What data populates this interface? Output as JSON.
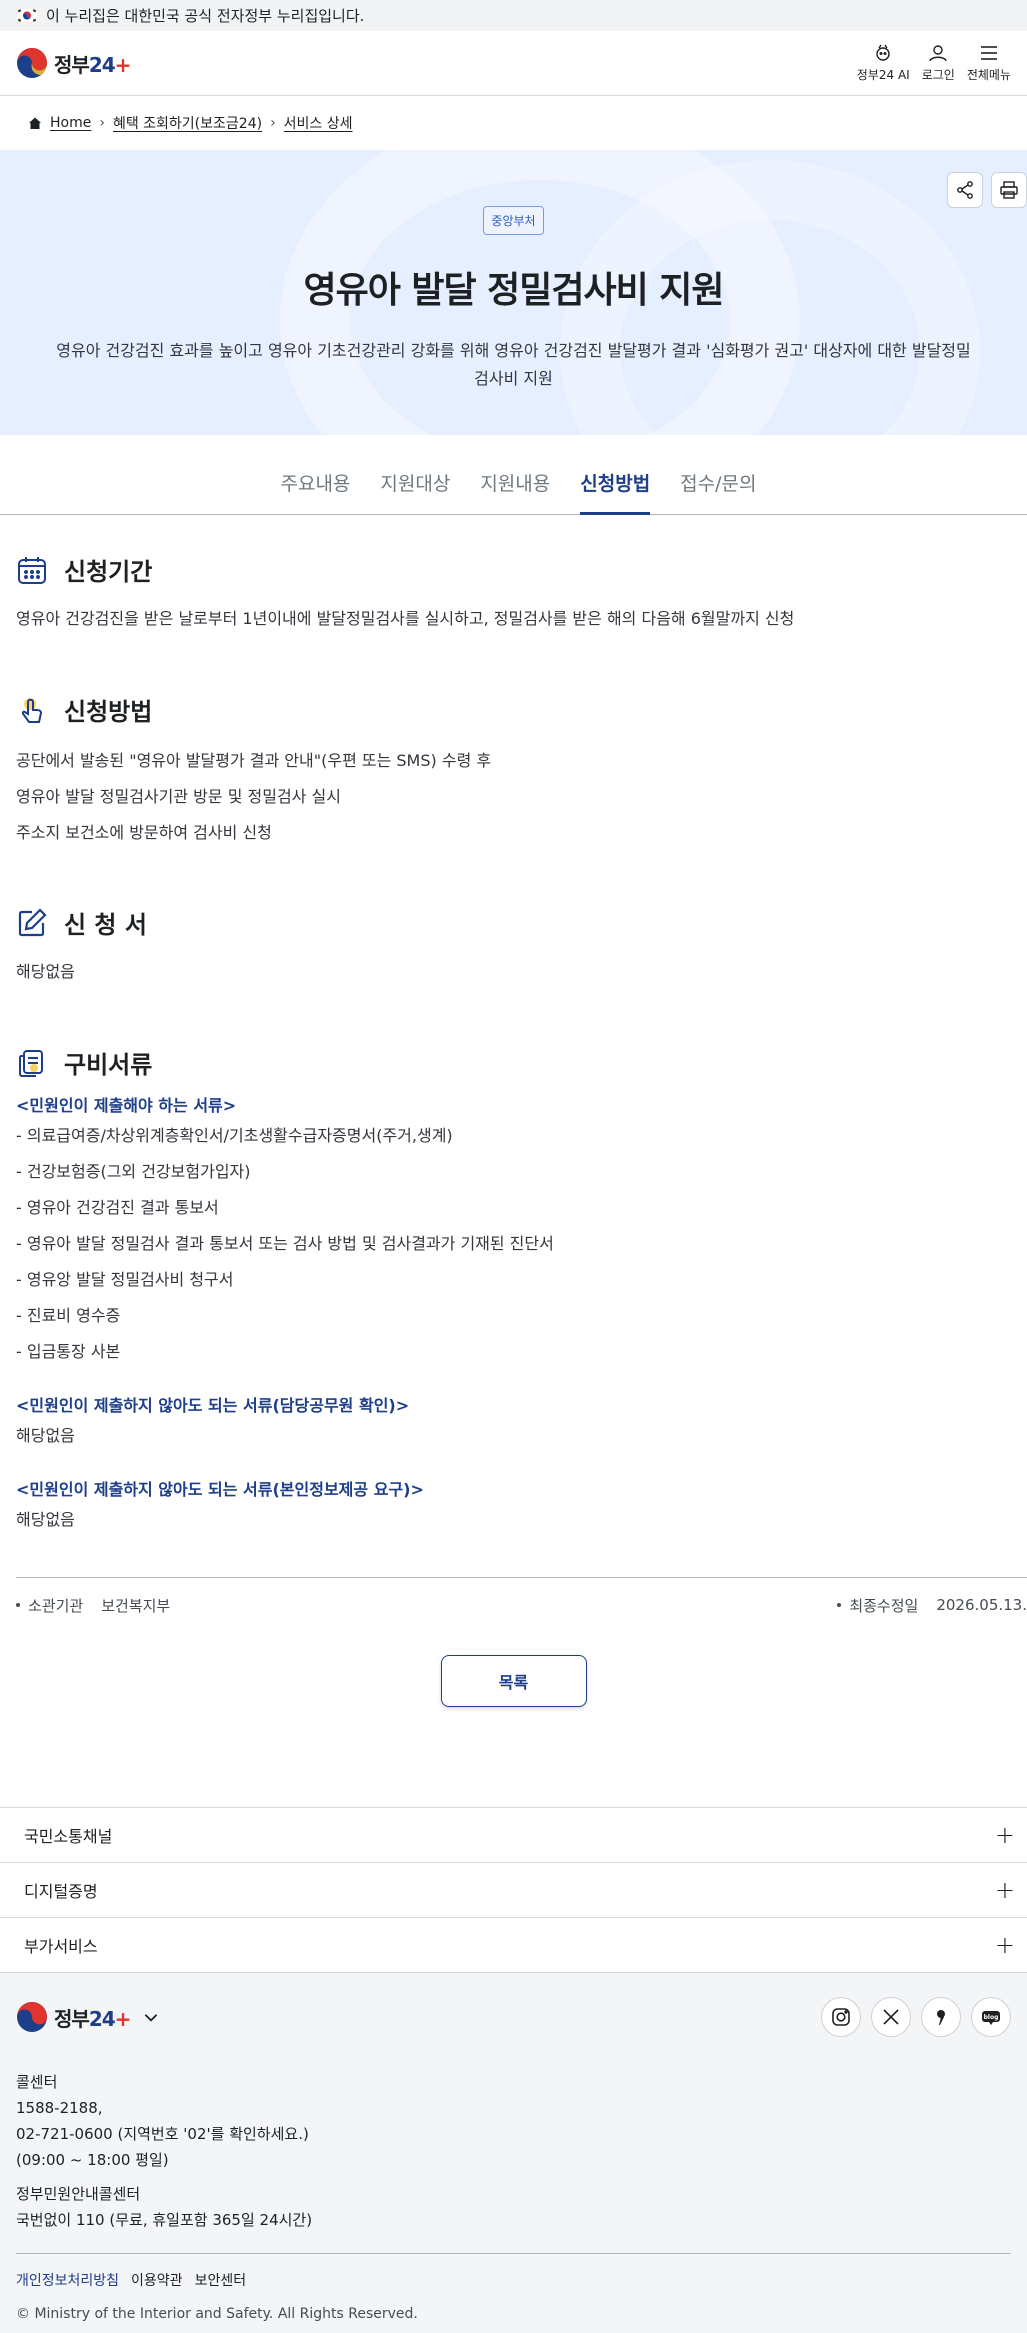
{
  "gov_banner": {
    "text": "이 누리집은 대한민국 공식 전자정부 누리집입니다."
  },
  "header": {
    "logo_text": "정부",
    "logo_num": "24",
    "util": [
      {
        "label": "정부24 AI",
        "icon": "ai-icon"
      },
      {
        "label": "로그인",
        "icon": "user-icon"
      },
      {
        "label": "전체메뉴",
        "icon": "menu-icon"
      }
    ]
  },
  "breadcrumb": {
    "home": "Home",
    "level1": "혜택 조회하기(보조금24)",
    "level2": "서비스 상세"
  },
  "hero": {
    "badge": "중앙부처",
    "title": "영유아 발달 정밀검사비 지원",
    "desc": "영유아 건강검진 효과를 높이고 영유아 기초건강관리 강화를 위해 영유아 건강검진 발달평가 결과 '심화평가 권고' 대상자에 대한 발달정밀검사비 지원"
  },
  "tabs": [
    {
      "label": "주요내용",
      "active": false
    },
    {
      "label": "지원대상",
      "active": false
    },
    {
      "label": "지원내용",
      "active": false
    },
    {
      "label": "신청방법",
      "active": true
    },
    {
      "label": "접수/문의",
      "active": false
    }
  ],
  "sections": {
    "period": {
      "title": "신청기간",
      "text": "영유아 건강검진을 받은 날로부터 1년이내에 발달정밀검사를 실시하고, 정밀검사를 받은 해의 다음해 6월말까지 신청"
    },
    "method": {
      "title": "신청방법",
      "lines": [
        "공단에서 발송된 \"영유아 발달평가 결과 안내\"(우편 또는 SMS) 수령 후",
        "영유아 발달 정밀검사기관 방문 및 정밀검사 실시",
        "주소지 보건소에 방문하여 검사비 신청"
      ]
    },
    "form": {
      "title": "신 청 서",
      "text": "해당없음"
    },
    "docs": {
      "title": "구비서류",
      "required_head": "<민원인이 제출해야 하는 서류>",
      "required": [
        "- 의료급여증/차상위계층확인서/기초생활수급자증명서(주거,생계)",
        "- 건강보험증(그외 건강보험가입자)",
        "- 영유아 건강검진 결과 통보서",
        "- 영유아 발달 정밀검사 결과 통보서 또는 검사 방법 및 검사결과가 기재된 진단서",
        "- 영유앙 발달 정밀검사비 청구서",
        "- 진료비 영수증",
        "- 입금통장 사본"
      ],
      "official_head": "<민원인이 제출하지 않아도 되는 서류(담당공무원 확인)>",
      "official_text": "해당없음",
      "consent_head": "<민원인이 제출하지 않아도 되는 서류(본인정보제공 요구)>",
      "consent_text": "해당없음"
    }
  },
  "meta": {
    "agency_label": "소관기관",
    "agency_value": "보건복지부",
    "updated_label": "최종수정일",
    "updated_value": "2026.05.13."
  },
  "list_button": "목록",
  "accordion": [
    {
      "label": "국민소통채널"
    },
    {
      "label": "디지털증명"
    },
    {
      "label": "부가서비스"
    }
  ],
  "footer": {
    "logo_text": "정부",
    "logo_num": "24",
    "social": [
      {
        "name": "instagram-icon"
      },
      {
        "name": "x-icon"
      },
      {
        "name": "brunch-icon"
      },
      {
        "name": "blog-icon",
        "label": "blog"
      }
    ],
    "callcenter_title": "콜센터",
    "callcenter_1": "1588-2188,",
    "callcenter_2": "02-721-0600 (지역번호 '02'를 확인하세요.)",
    "callcenter_3": "(09:00 ~ 18:00 평일)",
    "civil_title": "정부민원안내콜센터",
    "civil_text": "국번없이 110 (무료, 휴일포함 365일 24시간)",
    "links": [
      {
        "label": "개인정보처리방침",
        "strong": true
      },
      {
        "label": "이용약관",
        "strong": false
      },
      {
        "label": "보안센터",
        "strong": false
      }
    ],
    "copyright": "© Ministry of the Interior and Safety. All Rights Reserved."
  },
  "colors": {
    "primary": "#1d3e88",
    "hero_bg": "#e6efff",
    "footer_bg": "#f4f5f6"
  }
}
